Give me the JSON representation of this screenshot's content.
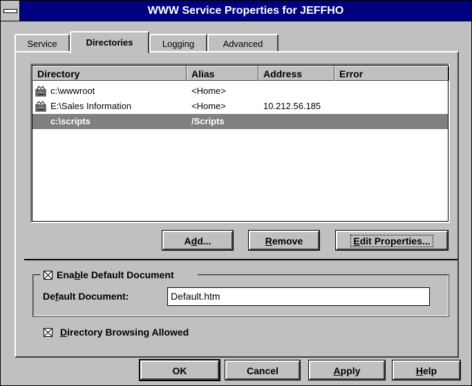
{
  "window": {
    "title": "WWW Service Properties for JEFFHO"
  },
  "tabs": [
    {
      "label": "Service"
    },
    {
      "label": "Directories"
    },
    {
      "label": "Logging"
    },
    {
      "label": "Advanced"
    }
  ],
  "directory_list": {
    "columns": [
      "Directory",
      "Alias",
      "Address",
      "Error"
    ],
    "rows": [
      {
        "directory": "c:\\wwwroot",
        "alias": "<Home>",
        "address": "",
        "error": "",
        "icon": "virtual-directory-icon"
      },
      {
        "directory": "E:\\Sales Information",
        "alias": "<Home>",
        "address": "10.212.56.185",
        "error": "",
        "icon": "virtual-directory-icon"
      },
      {
        "directory": "c:\\scripts",
        "alias": "/Scripts",
        "address": "",
        "error": "",
        "selected": true
      }
    ]
  },
  "list_buttons": {
    "add_pre": "A",
    "add_key": "d",
    "add_post": "d...",
    "remove_key": "R",
    "remove_post": "emove",
    "edit_key": "E",
    "edit_post": "dit Properties..."
  },
  "default_document": {
    "enable_pre": "Ena",
    "enable_key": "b",
    "enable_post": "le Default Document",
    "enabled": true,
    "field_pre": "De",
    "field_key": "f",
    "field_post": "ault Document:",
    "value": "Default.htm"
  },
  "directory_browsing": {
    "key": "D",
    "post": "irectory Browsing Allowed",
    "enabled": true
  },
  "dialog_buttons": {
    "ok": "OK",
    "cancel": "Cancel",
    "apply_key": "A",
    "apply_post": "pply",
    "help_key": "H",
    "help_post": "elp"
  },
  "colors": {
    "titlebar": "#000080",
    "selection": "#808080",
    "face": "#c0c0c0"
  }
}
